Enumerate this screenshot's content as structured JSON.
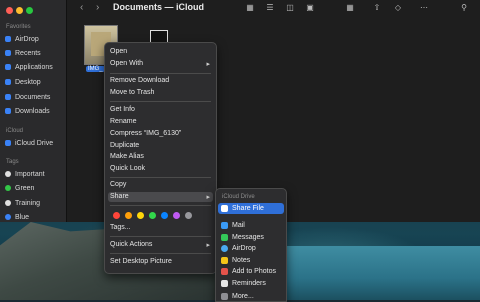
{
  "window": {
    "title": "Documents — iCloud"
  },
  "sidebar": {
    "favorites_heading": "Favorites",
    "favorites": [
      {
        "label": "AirDrop",
        "icon": "airdrop-icon"
      },
      {
        "label": "Recents",
        "icon": "clock-icon"
      },
      {
        "label": "Applications",
        "icon": "applications-icon"
      },
      {
        "label": "Desktop",
        "icon": "desktop-icon"
      },
      {
        "label": "Documents",
        "icon": "document-icon"
      },
      {
        "label": "Downloads",
        "icon": "download-icon"
      }
    ],
    "icloud_heading": "iCloud",
    "icloud": [
      {
        "label": "iCloud Drive",
        "icon": "cloud-icon"
      }
    ],
    "tags_heading": "Tags",
    "tags": [
      {
        "label": "Important",
        "color": "#e0e0e0"
      },
      {
        "label": "Green",
        "color": "#33c748"
      },
      {
        "label": "Training",
        "color": "#e0e0e0"
      },
      {
        "label": "Blue",
        "color": "#3a82f7"
      }
    ]
  },
  "files": [
    {
      "label": "IMG_"
    }
  ],
  "context_menu": {
    "items": [
      {
        "label": "Open"
      },
      {
        "label": "Open With",
        "submenu": true
      },
      {
        "label": "Remove Download"
      },
      {
        "label": "Move to Trash"
      },
      {
        "label": "Get Info"
      },
      {
        "label": "Rename"
      },
      {
        "label": "Compress “IMG_6130”"
      },
      {
        "label": "Duplicate"
      },
      {
        "label": "Make Alias"
      },
      {
        "label": "Quick Look"
      },
      {
        "label": "Copy"
      },
      {
        "label": "Share",
        "submenu": true
      },
      {
        "label": "Tags..."
      },
      {
        "label": "Quick Actions",
        "submenu": true
      },
      {
        "label": "Set Desktop Picture"
      }
    ],
    "tag_colors": [
      "#ff453a",
      "#ff9f0a",
      "#ffd60a",
      "#32d74b",
      "#0a84ff",
      "#bf5af2",
      "#98989d"
    ]
  },
  "share_menu": {
    "heading": "iCloud Drive",
    "items": [
      {
        "label": "Share File",
        "icon": "share-file-icon",
        "color": "#3a82f7"
      },
      {
        "label": "Mail",
        "icon": "mail-icon",
        "color": "#3a9bf7"
      },
      {
        "label": "Messages",
        "icon": "messages-icon",
        "color": "#34c759"
      },
      {
        "label": "AirDrop",
        "icon": "airdrop-icon",
        "color": "#4aa8f0"
      },
      {
        "label": "Notes",
        "icon": "notes-icon",
        "color": "#f5c518"
      },
      {
        "label": "Add to Photos",
        "icon": "photos-icon",
        "color": "#e5534b"
      },
      {
        "label": "Reminders",
        "icon": "reminders-icon",
        "color": "#e6e6e6"
      },
      {
        "label": "More...",
        "icon": "more-icon",
        "color": "#8e8e93"
      }
    ]
  }
}
